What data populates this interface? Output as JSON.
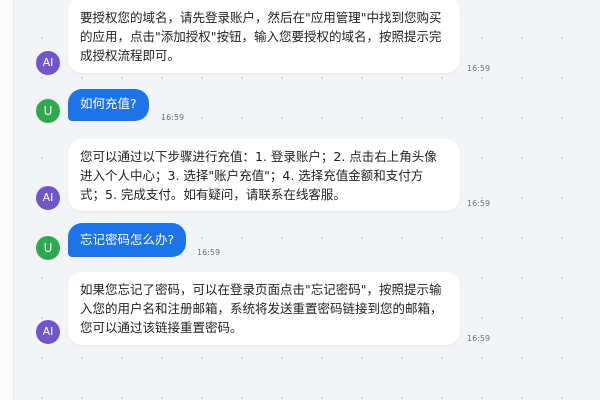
{
  "messages": [
    {
      "role": "ai",
      "avatar_label": "AI",
      "text": "要授权您的域名，请先登录账户，然后在\"应用管理\"中找到您购买的应用，点击\"添加授权\"按钮，输入您要授权的域名，按照提示完成授权流程即可。",
      "time": "16:59"
    },
    {
      "role": "user",
      "avatar_label": "U",
      "text": "如何充值?",
      "time": "16:59"
    },
    {
      "role": "ai",
      "avatar_label": "AI",
      "text": "您可以通过以下步骤进行充值：1. 登录账户；2. 点击右上角头像进入个人中心；3. 选择\"账户充值\"；4. 选择充值金额和支付方式；5. 完成支付。如有疑问，请联系在线客服。",
      "time": "16:59"
    },
    {
      "role": "user",
      "avatar_label": "U",
      "text": "忘记密码怎么办?",
      "time": "16:59"
    },
    {
      "role": "ai",
      "avatar_label": "AI",
      "text": "如果您忘记了密码，可以在登录页面点击\"忘记密码\"，按照提示输入您的用户名和注册邮箱，系统将发送重置密码链接到您的邮箱，您可以通过该链接重置密码。",
      "time": "16:59"
    }
  ]
}
